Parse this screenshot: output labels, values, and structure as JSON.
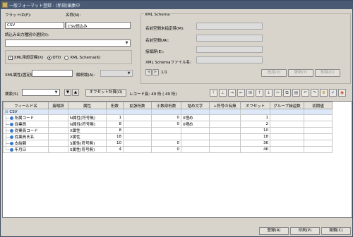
{
  "window": {
    "title": "一般フォーマット登録 - (新規)編集中"
  },
  "form": {
    "flat_id_label": "フラットID(F):",
    "flat_id_value": "CSV",
    "name_label": "名称(N):",
    "name_value": "CSV読込み",
    "select_label": "読込み出力種別の選択(I):",
    "select_value": "",
    "xml_settings_check_label": "XML用設定欄(X)",
    "dtd_label": "DTD",
    "xml_schema_radio_label": "XML Schema(K)",
    "xml_attr_label": "XML属性(固定値):",
    "xml_attr_value": "",
    "interp_label": "解釈論(A):",
    "interp_value": ""
  },
  "schema": {
    "group_title": "XML Schema",
    "ns_spec_label": "名前空間未指定時(M):",
    "ns_uri_label": "名前空間URI:",
    "prefix_label": "接頭辞(E):",
    "file_label": "XML Schemaファイル名:",
    "page_indicator": "1/1",
    "add_button": "追加(V)",
    "update_button": "更新(Y)",
    "delete_button": "削除(D)"
  },
  "toolbar": {
    "search_label": "検索(S)",
    "search_value": "",
    "offset_button": "オフセット計算(O)",
    "record_length": "レコード長: 49 桁 ( 49 桁)"
  },
  "grid": {
    "columns": [
      "フィールド名",
      "接頭辞",
      "属性",
      "桁数",
      "拡張桁数",
      "小数部桁数",
      "詰め文字",
      "+符号の有無",
      "オフセット",
      "グループ繰返数",
      "初期値"
    ],
    "root": "CSV",
    "rows": [
      {
        "name": "所属コード",
        "prefix": "",
        "attr": "N属性(符号無)",
        "digits": "1",
        "ext": "",
        "decimal": "0",
        "pad": "0埋め",
        "sign": "",
        "offset": "1",
        "group": "",
        "init": ""
      },
      {
        "name": "従業員",
        "prefix": "",
        "attr": "N属性(符号無)",
        "digits": "8",
        "ext": "",
        "decimal": "0",
        "pad": "0埋め",
        "sign": "",
        "offset": "2",
        "group": "",
        "init": ""
      },
      {
        "name": "従業員コード",
        "prefix": "",
        "attr": "X属性",
        "digits": "8",
        "ext": "",
        "decimal": "",
        "pad": "",
        "sign": "",
        "offset": "10",
        "group": "",
        "init": ""
      },
      {
        "name": "従業員氏名",
        "prefix": "",
        "attr": "X属性",
        "digits": "18",
        "ext": "",
        "decimal": "",
        "pad": "",
        "sign": "",
        "offset": "18",
        "group": "",
        "init": ""
      },
      {
        "name": "支給額",
        "prefix": "",
        "attr": "S属性(符号無)",
        "digits": "10",
        "ext": "",
        "decimal": "0",
        "pad": "",
        "sign": "",
        "offset": "36",
        "group": "",
        "init": ""
      },
      {
        "name": "年月日",
        "prefix": "",
        "attr": "S属性(符号無)",
        "digits": "4",
        "ext": "",
        "decimal": "0",
        "pad": "",
        "sign": "",
        "offset": "46",
        "group": "",
        "init": ""
      }
    ]
  },
  "footer": {
    "register_button": "登録(R)",
    "print_button": "印刷(P)",
    "close_button": "閉鎖(C)"
  }
}
